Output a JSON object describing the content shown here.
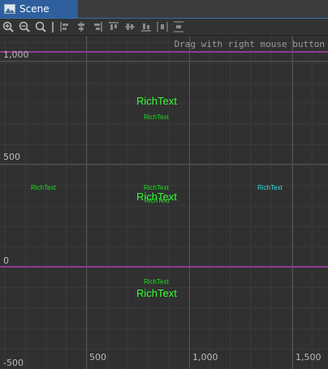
{
  "tab": {
    "label": "Scene",
    "icon": "scene-icon"
  },
  "toolbar": {
    "buttons": [
      {
        "name": "zoom-in-icon"
      },
      {
        "name": "zoom-out-icon"
      },
      {
        "name": "zoom-reset-icon"
      },
      {
        "name": "align-left-icon"
      },
      {
        "name": "align-center-h-icon"
      },
      {
        "name": "align-right-icon"
      },
      {
        "name": "align-top-icon"
      },
      {
        "name": "align-middle-v-icon"
      },
      {
        "name": "align-bottom-icon"
      },
      {
        "name": "distribute-h-icon"
      },
      {
        "name": "distribute-v-icon"
      }
    ]
  },
  "viewport": {
    "hint": "Drag with right mouse button",
    "y_labels": [
      "1,000",
      "500",
      "0",
      "-500"
    ],
    "x_labels": [
      "500",
      "1,000",
      "1,500"
    ],
    "nodes": [
      {
        "text": "RichText",
        "style": "big"
      },
      {
        "text": "RichText",
        "style": "small"
      },
      {
        "text": "RichText",
        "style": "small"
      },
      {
        "text": "RichText",
        "style": "small"
      },
      {
        "text": "RichText",
        "style": "small-cyan"
      },
      {
        "text": "RichText",
        "style": "big"
      },
      {
        "text": "RichText",
        "style": "small"
      },
      {
        "text": "RichText",
        "style": "small"
      },
      {
        "text": "RichText",
        "style": "big"
      }
    ]
  }
}
